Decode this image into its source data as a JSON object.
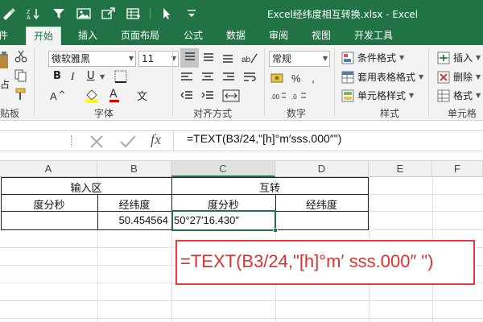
{
  "window": {
    "title": "Excel经纬度相互转换.xlsx - Excel"
  },
  "ribbon_tabs": [
    "件",
    "开始",
    "插入",
    "页面布局",
    "公式",
    "数据",
    "审阅",
    "视图",
    "开发工具"
  ],
  "ribbon": {
    "font_name": "微软雅黑",
    "font_size": "11",
    "number_format": "常规",
    "bold": "B",
    "italic": "I",
    "underline": "U",
    "font_color_glyph": "A",
    "wen": "文",
    "styles": {
      "conditional": "条件格式",
      "table": "套用表格格式",
      "cell": "单元格样式"
    },
    "cells": {
      "insert": "插入",
      "delete": "删除",
      "format": "格式"
    },
    "groups": {
      "clipboard": "贴板",
      "font": "字体",
      "alignment": "对齐方式",
      "number": "数字",
      "styles": "样式",
      "cells": "单元格"
    },
    "paste_fragment": "占"
  },
  "formula_bar": {
    "formula": "=TEXT(B3/24,\"[h]°m′sss.000″\")",
    "fx": "fx"
  },
  "columns": [
    "A",
    "B",
    "C",
    "D",
    "E",
    "F"
  ],
  "table": {
    "header_left": "输入区",
    "header_right": "互转",
    "sub_headers": [
      "度分秒",
      "经纬度",
      "度分秒",
      "经纬度"
    ],
    "row3": {
      "B": "50.454564",
      "C": "50°27′16.430″"
    }
  },
  "callout": {
    "text": "=TEXT(B3/24,\"[h]°m′ sss.000″ \")"
  }
}
